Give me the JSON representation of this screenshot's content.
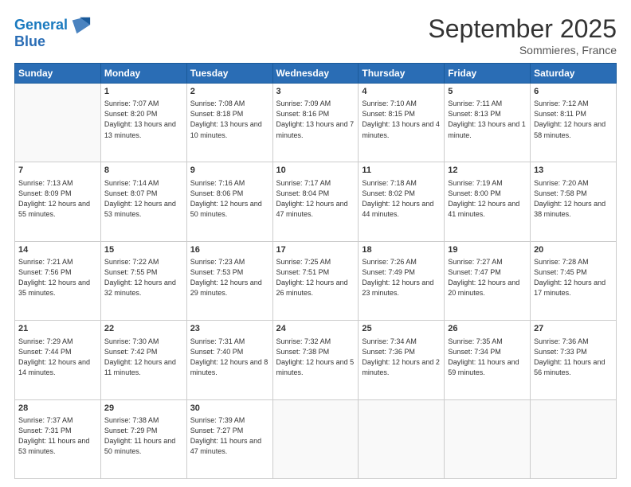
{
  "header": {
    "logo_line1": "General",
    "logo_line2": "Blue",
    "month_title": "September 2025",
    "location": "Sommieres, France"
  },
  "weekdays": [
    "Sunday",
    "Monday",
    "Tuesday",
    "Wednesday",
    "Thursday",
    "Friday",
    "Saturday"
  ],
  "weeks": [
    [
      {
        "day": "",
        "sunrise": "",
        "sunset": "",
        "daylight": ""
      },
      {
        "day": "1",
        "sunrise": "Sunrise: 7:07 AM",
        "sunset": "Sunset: 8:20 PM",
        "daylight": "Daylight: 13 hours and 13 minutes."
      },
      {
        "day": "2",
        "sunrise": "Sunrise: 7:08 AM",
        "sunset": "Sunset: 8:18 PM",
        "daylight": "Daylight: 13 hours and 10 minutes."
      },
      {
        "day": "3",
        "sunrise": "Sunrise: 7:09 AM",
        "sunset": "Sunset: 8:16 PM",
        "daylight": "Daylight: 13 hours and 7 minutes."
      },
      {
        "day": "4",
        "sunrise": "Sunrise: 7:10 AM",
        "sunset": "Sunset: 8:15 PM",
        "daylight": "Daylight: 13 hours and 4 minutes."
      },
      {
        "day": "5",
        "sunrise": "Sunrise: 7:11 AM",
        "sunset": "Sunset: 8:13 PM",
        "daylight": "Daylight: 13 hours and 1 minute."
      },
      {
        "day": "6",
        "sunrise": "Sunrise: 7:12 AM",
        "sunset": "Sunset: 8:11 PM",
        "daylight": "Daylight: 12 hours and 58 minutes."
      }
    ],
    [
      {
        "day": "7",
        "sunrise": "Sunrise: 7:13 AM",
        "sunset": "Sunset: 8:09 PM",
        "daylight": "Daylight: 12 hours and 55 minutes."
      },
      {
        "day": "8",
        "sunrise": "Sunrise: 7:14 AM",
        "sunset": "Sunset: 8:07 PM",
        "daylight": "Daylight: 12 hours and 53 minutes."
      },
      {
        "day": "9",
        "sunrise": "Sunrise: 7:16 AM",
        "sunset": "Sunset: 8:06 PM",
        "daylight": "Daylight: 12 hours and 50 minutes."
      },
      {
        "day": "10",
        "sunrise": "Sunrise: 7:17 AM",
        "sunset": "Sunset: 8:04 PM",
        "daylight": "Daylight: 12 hours and 47 minutes."
      },
      {
        "day": "11",
        "sunrise": "Sunrise: 7:18 AM",
        "sunset": "Sunset: 8:02 PM",
        "daylight": "Daylight: 12 hours and 44 minutes."
      },
      {
        "day": "12",
        "sunrise": "Sunrise: 7:19 AM",
        "sunset": "Sunset: 8:00 PM",
        "daylight": "Daylight: 12 hours and 41 minutes."
      },
      {
        "day": "13",
        "sunrise": "Sunrise: 7:20 AM",
        "sunset": "Sunset: 7:58 PM",
        "daylight": "Daylight: 12 hours and 38 minutes."
      }
    ],
    [
      {
        "day": "14",
        "sunrise": "Sunrise: 7:21 AM",
        "sunset": "Sunset: 7:56 PM",
        "daylight": "Daylight: 12 hours and 35 minutes."
      },
      {
        "day": "15",
        "sunrise": "Sunrise: 7:22 AM",
        "sunset": "Sunset: 7:55 PM",
        "daylight": "Daylight: 12 hours and 32 minutes."
      },
      {
        "day": "16",
        "sunrise": "Sunrise: 7:23 AM",
        "sunset": "Sunset: 7:53 PM",
        "daylight": "Daylight: 12 hours and 29 minutes."
      },
      {
        "day": "17",
        "sunrise": "Sunrise: 7:25 AM",
        "sunset": "Sunset: 7:51 PM",
        "daylight": "Daylight: 12 hours and 26 minutes."
      },
      {
        "day": "18",
        "sunrise": "Sunrise: 7:26 AM",
        "sunset": "Sunset: 7:49 PM",
        "daylight": "Daylight: 12 hours and 23 minutes."
      },
      {
        "day": "19",
        "sunrise": "Sunrise: 7:27 AM",
        "sunset": "Sunset: 7:47 PM",
        "daylight": "Daylight: 12 hours and 20 minutes."
      },
      {
        "day": "20",
        "sunrise": "Sunrise: 7:28 AM",
        "sunset": "Sunset: 7:45 PM",
        "daylight": "Daylight: 12 hours and 17 minutes."
      }
    ],
    [
      {
        "day": "21",
        "sunrise": "Sunrise: 7:29 AM",
        "sunset": "Sunset: 7:44 PM",
        "daylight": "Daylight: 12 hours and 14 minutes."
      },
      {
        "day": "22",
        "sunrise": "Sunrise: 7:30 AM",
        "sunset": "Sunset: 7:42 PM",
        "daylight": "Daylight: 12 hours and 11 minutes."
      },
      {
        "day": "23",
        "sunrise": "Sunrise: 7:31 AM",
        "sunset": "Sunset: 7:40 PM",
        "daylight": "Daylight: 12 hours and 8 minutes."
      },
      {
        "day": "24",
        "sunrise": "Sunrise: 7:32 AM",
        "sunset": "Sunset: 7:38 PM",
        "daylight": "Daylight: 12 hours and 5 minutes."
      },
      {
        "day": "25",
        "sunrise": "Sunrise: 7:34 AM",
        "sunset": "Sunset: 7:36 PM",
        "daylight": "Daylight: 12 hours and 2 minutes."
      },
      {
        "day": "26",
        "sunrise": "Sunrise: 7:35 AM",
        "sunset": "Sunset: 7:34 PM",
        "daylight": "Daylight: 11 hours and 59 minutes."
      },
      {
        "day": "27",
        "sunrise": "Sunrise: 7:36 AM",
        "sunset": "Sunset: 7:33 PM",
        "daylight": "Daylight: 11 hours and 56 minutes."
      }
    ],
    [
      {
        "day": "28",
        "sunrise": "Sunrise: 7:37 AM",
        "sunset": "Sunset: 7:31 PM",
        "daylight": "Daylight: 11 hours and 53 minutes."
      },
      {
        "day": "29",
        "sunrise": "Sunrise: 7:38 AM",
        "sunset": "Sunset: 7:29 PM",
        "daylight": "Daylight: 11 hours and 50 minutes."
      },
      {
        "day": "30",
        "sunrise": "Sunrise: 7:39 AM",
        "sunset": "Sunset: 7:27 PM",
        "daylight": "Daylight: 11 hours and 47 minutes."
      },
      {
        "day": "",
        "sunrise": "",
        "sunset": "",
        "daylight": ""
      },
      {
        "day": "",
        "sunrise": "",
        "sunset": "",
        "daylight": ""
      },
      {
        "day": "",
        "sunrise": "",
        "sunset": "",
        "daylight": ""
      },
      {
        "day": "",
        "sunrise": "",
        "sunset": "",
        "daylight": ""
      }
    ]
  ]
}
